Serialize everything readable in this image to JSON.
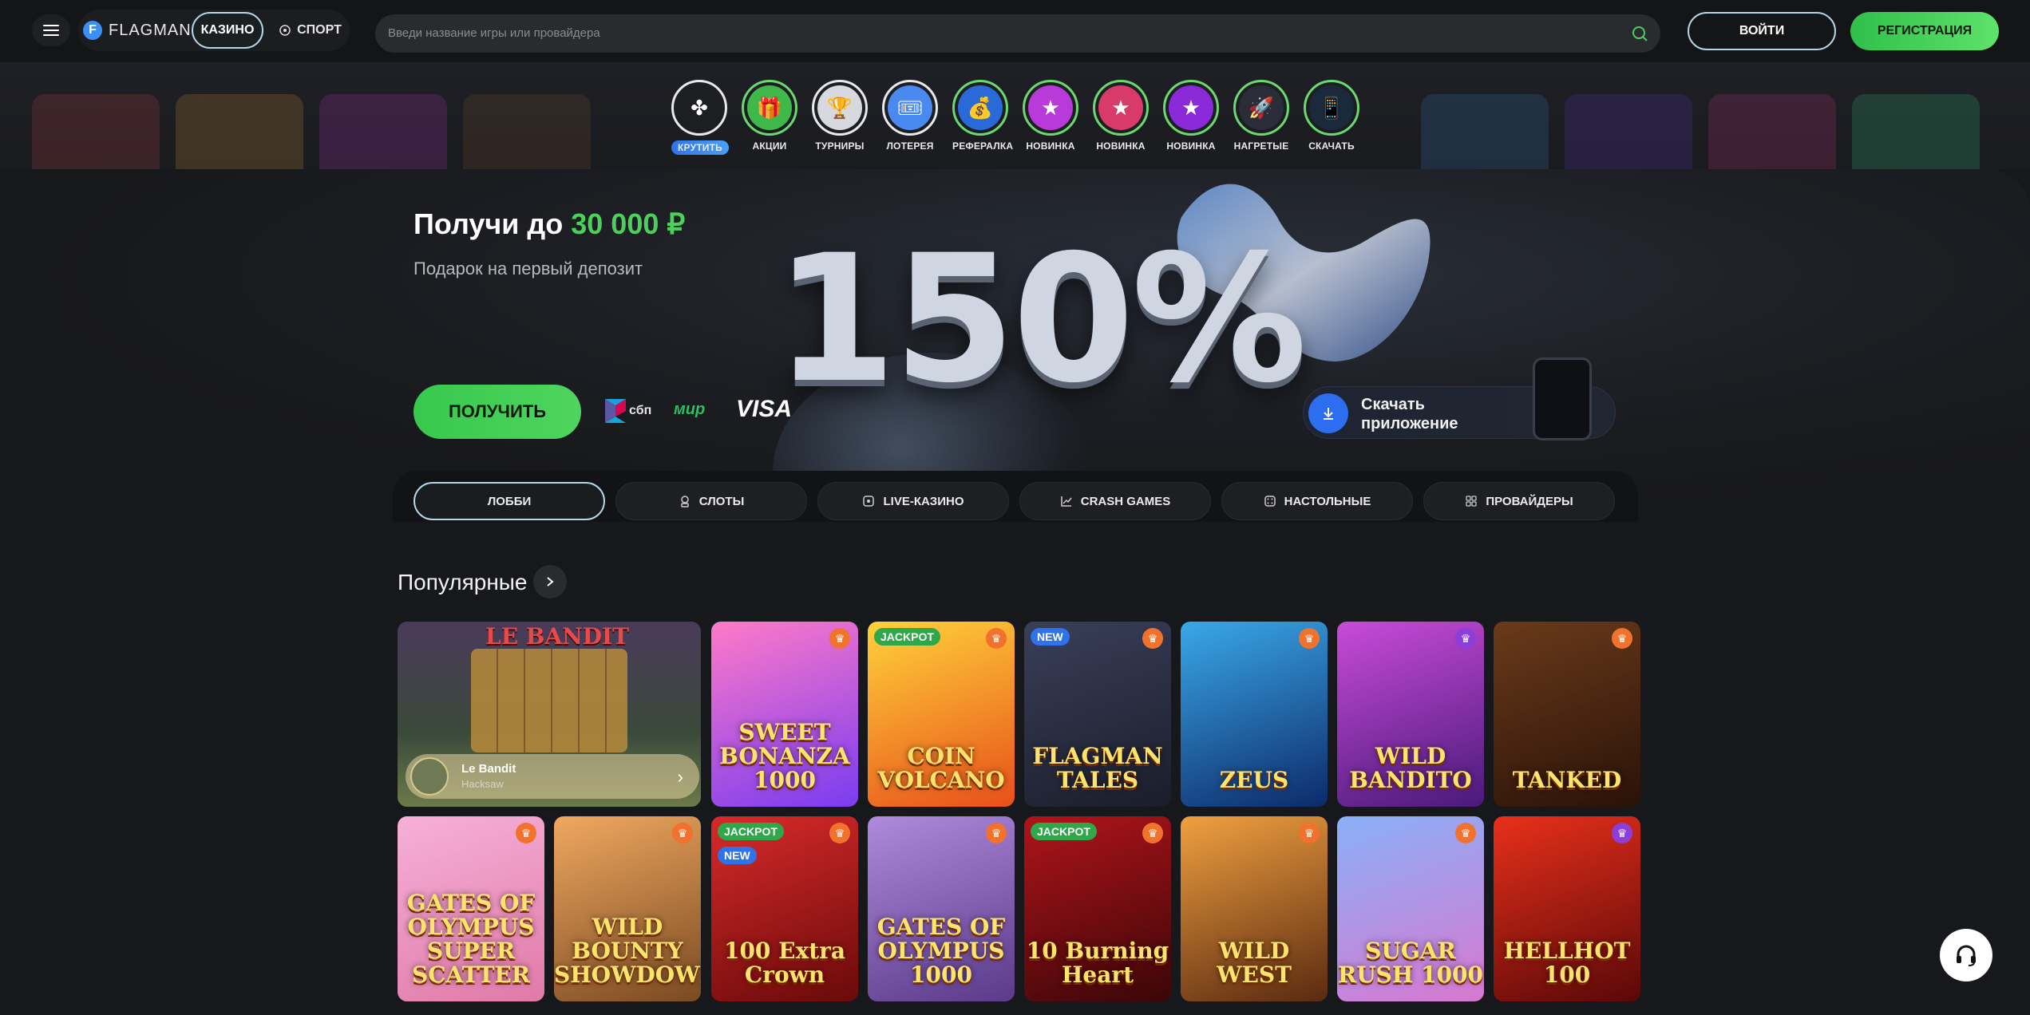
{
  "header": {
    "logo_text": "FLAGMAN",
    "logo_mark": "F",
    "casino_label": "КАЗИНО",
    "sport_label": "СПОРТ",
    "search_placeholder": "Введи название игры или провайдера",
    "login_label": "ВОЙТИ",
    "register_label": "РЕГИСТРАЦИЯ"
  },
  "stories": [
    {
      "label": "КРУТИТЬ",
      "icon": "wheel-icon",
      "active": true
    },
    {
      "label": "АКЦИИ",
      "icon": "gift-icon"
    },
    {
      "label": "ТУРНИРЫ",
      "icon": "cup-icon"
    },
    {
      "label": "ЛОТЕРЕЯ",
      "icon": "ticket-icon"
    },
    {
      "label": "РЕФЕРАЛКА",
      "icon": "bag-icon"
    },
    {
      "label": "НОВИНКА",
      "icon": "new-icon"
    },
    {
      "label": "НОВИНКА",
      "icon": "new-icon"
    },
    {
      "label": "НОВИНКА",
      "icon": "new-icon"
    },
    {
      "label": "НАГРЕТЫЕ",
      "icon": "rocket-icon"
    },
    {
      "label": "СКАЧАТЬ",
      "icon": "download-icon"
    }
  ],
  "hero": {
    "title_prefix": "Получи до ",
    "title_amount": "30 000 ₽",
    "subtitle": "Подарок на первый депозит",
    "percent": "150%",
    "cta_label": "ПОЛУЧИТЬ",
    "pay_sbp": "сбп",
    "pay_mir": "мир",
    "pay_visa": "VISA",
    "app_label": "Скачать приложение"
  },
  "tabs": [
    {
      "label": "ЛОББИ",
      "icon": "",
      "active": true
    },
    {
      "label": "СЛОТЫ",
      "icon": "slot-icon"
    },
    {
      "label": "LIVE-КАЗИНО",
      "icon": "live-icon"
    },
    {
      "label": "CRASH GAMES",
      "icon": "chart-icon"
    },
    {
      "label": "НАСТОЛЬНЫЕ",
      "icon": "dice-icon"
    },
    {
      "label": "ПРОВАЙДЕРЫ",
      "icon": "grid-icon"
    }
  ],
  "popular": {
    "title": "Популярные",
    "featured": {
      "name": "Le Bandit",
      "provider": "Hacksaw",
      "art_title": "LE BANDIT"
    },
    "games": [
      {
        "title": "SWEET BONANZA 1000",
        "badge": "",
        "color1": "#ff7ac8",
        "color2": "#7a3cf0"
      },
      {
        "title": "COIN VOLCANO",
        "badge": "JACKPOT",
        "color1": "#ffd23a",
        "color2": "#e8501a"
      },
      {
        "title": "FLAGMAN TALES",
        "badge": "NEW",
        "color1": "#3a3f5a",
        "color2": "#1a1d2a"
      },
      {
        "title": "ZEUS",
        "badge": "",
        "color1": "#3aa8e8",
        "color2": "#0d2a6a"
      },
      {
        "title": "WILD BANDITO",
        "badge": "",
        "color1": "#c84bd8",
        "color2": "#4a1a7a",
        "trophy": "purple"
      },
      {
        "title": "TANKED",
        "badge": "",
        "color1": "#6a3a1a",
        "color2": "#2a1208"
      },
      {
        "title": "GATES OF OLYMPUS SUPER SCATTER",
        "badge": "",
        "color1": "#f6b0d8",
        "color2": "#e07aa8"
      },
      {
        "title": "WILD BOUNTY SHOWDOWN",
        "badge": "",
        "color1": "#f0a860",
        "color2": "#7a4a22"
      },
      {
        "title": "100 Extra Crown",
        "badge": "JACKPOT",
        "badge2": "NEW",
        "color1": "#d82a2a",
        "color2": "#6a0a0a"
      },
      {
        "title": "GATES OF OLYMPUS 1000",
        "badge": "",
        "color1": "#b08adc",
        "color2": "#5a3a8a"
      },
      {
        "title": "10 Burning Heart",
        "badge": "JACKPOT",
        "color1": "#b0141a",
        "color2": "#3a0608"
      },
      {
        "title": "WILD WEST",
        "badge": "",
        "color1": "#f0a040",
        "color2": "#5a2a10"
      },
      {
        "title": "SUGAR RUSH 1000",
        "badge": "",
        "color1": "#8ab0f8",
        "color2": "#d878d0"
      },
      {
        "title": "HELLHOT 100",
        "badge": "",
        "color1": "#e8301a",
        "color2": "#5a0808",
        "trophy": "purple"
      }
    ]
  },
  "colors": {
    "accent_green": "#4bd05a",
    "accent_blue": "#2f73ea",
    "bg": "#17181b"
  }
}
